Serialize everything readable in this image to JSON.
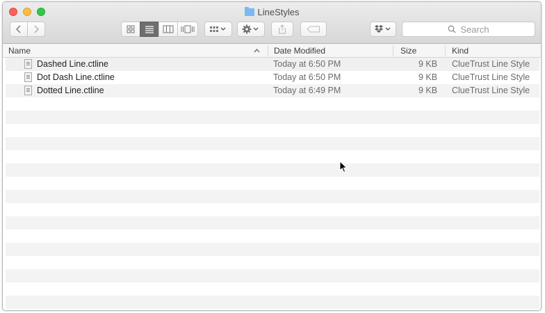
{
  "window": {
    "title": "LineStyles"
  },
  "toolbar": {
    "search_placeholder": "Search"
  },
  "header": {
    "name": "Name",
    "date_modified": "Date Modified",
    "size": "Size",
    "kind": "Kind"
  },
  "files": [
    {
      "name": "Dashed Line.ctline",
      "date": "Today at 6:50 PM",
      "size": "9 KB",
      "kind": "ClueTrust Line Style"
    },
    {
      "name": "Dot Dash Line.ctline",
      "date": "Today at 6:50 PM",
      "size": "9 KB",
      "kind": "ClueTrust Line Style"
    },
    {
      "name": "Dotted Line.ctline",
      "date": "Today at 6:49 PM",
      "size": "9 KB",
      "kind": "ClueTrust Line Style"
    }
  ]
}
